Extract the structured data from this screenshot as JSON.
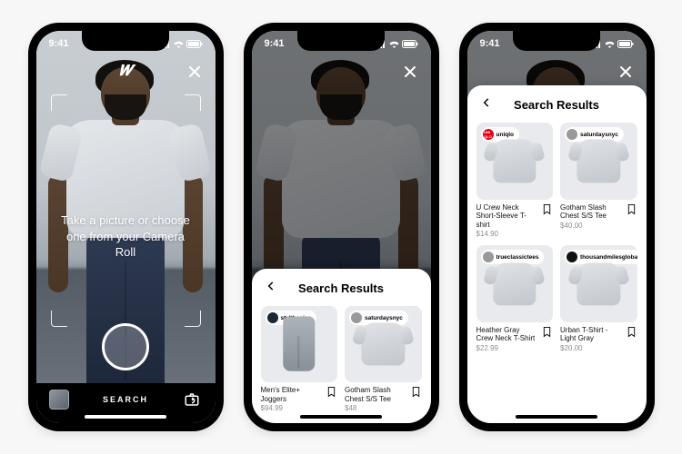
{
  "status": {
    "time": "9:41"
  },
  "camera": {
    "prompt": "Take a picture or choose one from your Camera Roll",
    "search_label": "SEARCH"
  },
  "sheet": {
    "title": "Search Results"
  },
  "phone2_results": [
    {
      "brand": "styltbasics",
      "title": "Men's Elite+ Joggers",
      "price": "$94.99",
      "shape": "pants",
      "brand_color": "navy"
    },
    {
      "brand": "saturdaysnyc",
      "title": "Gotham Slash Chest S/S Tee",
      "price": "$48",
      "shape": "tee",
      "brand_color": "grey"
    }
  ],
  "phone3_results": [
    {
      "brand": "uniqlo",
      "title": "U Crew Neck Short-Sleeve T-shirt",
      "price": "$14.90",
      "shape": "tee",
      "brand_color": "red"
    },
    {
      "brand": "saturdaysnyc",
      "title": "Gotham Slash Chest S/S Tee",
      "price": "$40.00",
      "shape": "tee",
      "brand_color": "grey"
    },
    {
      "brand": "trueclassictees",
      "title": "Heather Gray Crew Neck T-Shirt",
      "price": "$22.99",
      "shape": "tee",
      "brand_color": "grey"
    },
    {
      "brand": "thousandmilesglobal",
      "title": "Urban T-Shirt - Light Gray",
      "price": "$20.00",
      "shape": "tee",
      "brand_color": "black"
    }
  ]
}
